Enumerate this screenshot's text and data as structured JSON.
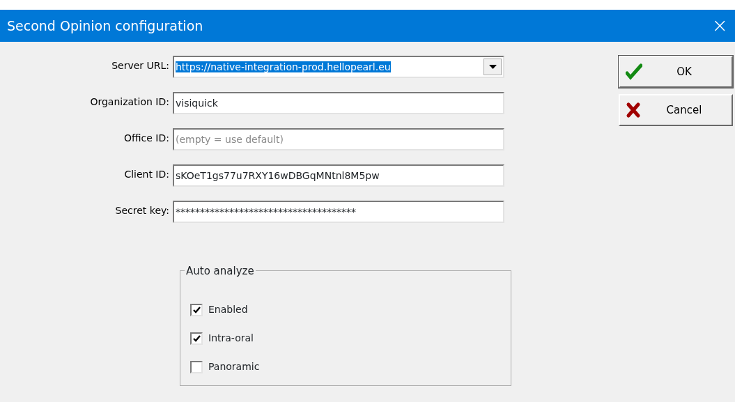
{
  "window": {
    "title": "Second Opinion configuration",
    "close": "×"
  },
  "fields": [
    {
      "label": "Server URL:",
      "kind": "combo",
      "value": "https://native-integration-prod.hellopearl.eu",
      "text_selected": true
    },
    {
      "label": "Organization ID:",
      "kind": "text",
      "value": "visiquick",
      "text_selected": false
    },
    {
      "label": "Office ID:",
      "kind": "text",
      "placeholder": "(empty = use default)"
    },
    {
      "label": "Client ID:",
      "kind": "text",
      "value": "sKOeT1gs77u7RXY16wDBGqMNtnl8M5pw",
      "text_selected": false
    },
    {
      "label": "Secret key:",
      "kind": "text",
      "value": "*************************************",
      "text_selected": false
    }
  ],
  "buttons": [
    {
      "label": "OK",
      "kind": "ok",
      "default": true
    },
    {
      "label": "Cancel",
      "kind": "cancel",
      "default": false
    }
  ],
  "auto_analyze": {
    "title": "Auto analyze",
    "options": [
      {
        "label": "Enabled",
        "checked": true
      },
      {
        "label": "Intra-oral",
        "checked": true
      },
      {
        "label": "Panoramic",
        "checked": false
      }
    ]
  }
}
